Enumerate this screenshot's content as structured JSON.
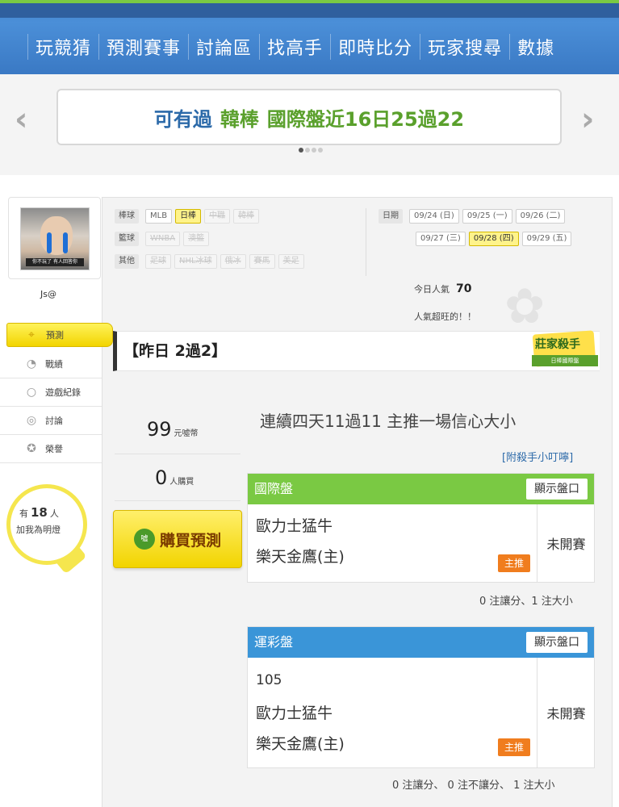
{
  "nav": {
    "items": [
      "玩競猜",
      "預測賽事",
      "討論區",
      "找高手",
      "即時比分",
      "玩家搜尋",
      "數據"
    ]
  },
  "banner": {
    "part1": "可有過",
    "part2": "韓棒",
    "part3": "國際盤近16日25過22",
    "prev_icon": "chevron-left-icon",
    "next_icon": "chevron-right-icon"
  },
  "user": {
    "name": "Js@",
    "avatar_caption": "你不玩了 有人回答你"
  },
  "sidebar": {
    "items": [
      {
        "label": "預測",
        "icon": "target-icon"
      },
      {
        "label": "戰績",
        "icon": "chart-icon"
      },
      {
        "label": "遊戲紀錄",
        "icon": "record-icon"
      },
      {
        "label": "討論",
        "icon": "chat-icon"
      },
      {
        "label": "榮譽",
        "icon": "medal-icon"
      }
    ],
    "fans_prefix": "有",
    "fans_count": "18",
    "fans_suffix": "人",
    "fans_text": "加我為明燈"
  },
  "filters": {
    "baseball": {
      "tag": "棒球",
      "items": [
        "MLB",
        "日棒",
        "中職",
        "韓棒"
      ]
    },
    "basketball": {
      "tag": "籃球",
      "items": [
        "WNBA",
        "澳籃"
      ]
    },
    "other": {
      "tag": "其他",
      "items": [
        "足球",
        "NHL冰球",
        "俄冰",
        "賽馬",
        "美足"
      ]
    },
    "date_tag": "日期",
    "dates_row1": [
      "09/24 (日)",
      "09/25 (一)",
      "09/26 (二)"
    ],
    "dates_row2": [
      "09/27 (三)",
      "09/28 (四)",
      "09/29 (五)"
    ]
  },
  "popularity": {
    "label": "今日人氣",
    "value": "70",
    "note": "人氣超旺的！！"
  },
  "yesterday": "【昨日 2過2】",
  "badge": {
    "title": "莊家殺手",
    "sub": "日棒國際盤"
  },
  "stats": {
    "coins": "99",
    "coins_unit": "元噓幣",
    "buyers": "0",
    "buyers_unit": "人購買"
  },
  "buy_button": {
    "label": "購買預測",
    "icon_text": "噓"
  },
  "headline": "連續四天11過11 主推一場信心大小",
  "tips_link": "[附殺手小叮嚀]",
  "panels": [
    {
      "title": "國際盤",
      "show_label": "顯示盤口",
      "color": "#7ac943",
      "line": "",
      "team1": "歐力士猛牛",
      "team2": "樂天金鷹(主)",
      "pick": "主推",
      "status": "未開賽",
      "note": "0 注讓分、1 注大小"
    },
    {
      "title": "運彩盤",
      "show_label": "顯示盤口",
      "color": "#3a95d8",
      "line": "105",
      "team1": "歐力士猛牛",
      "team2": "樂天金鷹(主)",
      "pick": "主推",
      "status": "未開賽",
      "note": "0 注讓分、 0 注不讓分、 1 注大小"
    }
  ]
}
